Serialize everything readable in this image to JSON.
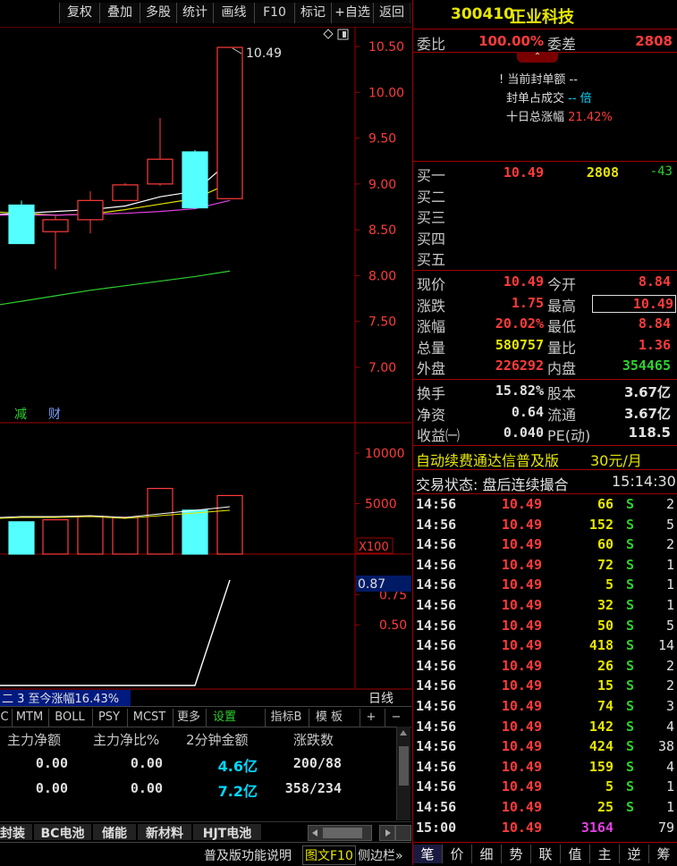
{
  "toolbar": {
    "items": [
      "复权",
      "叠加",
      "多股",
      "统计",
      "画线",
      "F10",
      "标记",
      "+自选",
      "返回"
    ]
  },
  "stock": {
    "code": "300410",
    "name": "正业科技"
  },
  "order_ratio": {
    "wb_label": "委比",
    "wb_value": "100.00%",
    "wc_label": "委差",
    "wc_value": "2808"
  },
  "seal": {
    "l1_label": "当前封单额",
    "l1_value": "--",
    "l2_label": "封单占成交",
    "l2_value": "-- 倍",
    "l3_label": "十日总涨幅",
    "l3_value": "21.42%"
  },
  "bids": [
    {
      "label": "买一",
      "price": "10.49",
      "vol": "2808",
      "chg": "-43"
    },
    {
      "label": "买二",
      "price": "",
      "vol": "",
      "chg": ""
    },
    {
      "label": "买三",
      "price": "",
      "vol": "",
      "chg": ""
    },
    {
      "label": "买四",
      "price": "",
      "vol": "",
      "chg": ""
    },
    {
      "label": "买五",
      "price": "",
      "vol": "",
      "chg": ""
    }
  ],
  "quote": [
    {
      "l1": "现价",
      "v1": "10.49",
      "l2": "今开",
      "v2": "8.84"
    },
    {
      "l1": "涨跌",
      "v1": "1.75",
      "l2": "最高",
      "v2": "10.49"
    },
    {
      "l1": "涨幅",
      "v1": "20.02%",
      "l2": "最低",
      "v2": "8.84"
    },
    {
      "l1": "总量",
      "v1": "580757",
      "l2": "量比",
      "v2": "1.36"
    },
    {
      "l1": "外盘",
      "v1": "226292",
      "l2": "内盘",
      "v2": "354465"
    }
  ],
  "stats": [
    {
      "l1": "换手",
      "v1": "15.82%",
      "l2": "股本",
      "v2": "3.67亿"
    },
    {
      "l1": "净资",
      "v1": "0.64",
      "l2": "流通",
      "v2": "3.67亿"
    },
    {
      "l1": "收益㈠",
      "v1": "0.040",
      "l2": "PE(动)",
      "v2": "118.5"
    }
  ],
  "promo": {
    "text": "自动续费通达信普及版",
    "price": "30元/月"
  },
  "trade_status": {
    "label": "交易状态: 盘后连续撮合",
    "time": "15:14:30"
  },
  "ticks": [
    [
      "14:56",
      "10.49",
      "66",
      "S",
      "2"
    ],
    [
      "14:56",
      "10.49",
      "152",
      "S",
      "5"
    ],
    [
      "14:56",
      "10.49",
      "60",
      "S",
      "2"
    ],
    [
      "14:56",
      "10.49",
      "72",
      "S",
      "1"
    ],
    [
      "14:56",
      "10.49",
      "5",
      "S",
      "1"
    ],
    [
      "14:56",
      "10.49",
      "32",
      "S",
      "1"
    ],
    [
      "14:56",
      "10.49",
      "50",
      "S",
      "5"
    ],
    [
      "14:56",
      "10.49",
      "418",
      "S",
      "14"
    ],
    [
      "14:56",
      "10.49",
      "26",
      "S",
      "2"
    ],
    [
      "14:56",
      "10.49",
      "15",
      "S",
      "2"
    ],
    [
      "14:56",
      "10.49",
      "74",
      "S",
      "3"
    ],
    [
      "14:56",
      "10.49",
      "142",
      "S",
      "4"
    ],
    [
      "14:56",
      "10.49",
      "424",
      "S",
      "38"
    ],
    [
      "14:56",
      "10.49",
      "159",
      "S",
      "4"
    ],
    [
      "14:56",
      "10.49",
      "5",
      "S",
      "1"
    ],
    [
      "14:56",
      "10.49",
      "25",
      "S",
      "1"
    ],
    [
      "15:00",
      "10.49",
      "3164",
      "",
      "79"
    ]
  ],
  "rp_tabs": [
    "笔",
    "价",
    "细",
    "势",
    "联",
    "值",
    "主",
    "逆",
    "筹"
  ],
  "chart_data": [
    {
      "type": "candlestick",
      "yticks": [
        "10.50",
        "10.00",
        "9.50",
        "9.00",
        "8.50",
        "8.00",
        "7.50",
        "7.00"
      ],
      "max_label": "10.49",
      "candles": [
        {
          "open": 8.77,
          "close": 8.35,
          "high": 8.82,
          "low": 8.35
        },
        {
          "open": 8.48,
          "close": 8.61,
          "high": 8.65,
          "low": 8.07
        },
        {
          "open": 8.61,
          "close": 8.82,
          "high": 8.92,
          "low": 8.46
        },
        {
          "open": 8.82,
          "close": 8.99,
          "high": 9.01,
          "low": 8.82
        },
        {
          "open": 9.0,
          "close": 9.27,
          "high": 9.72,
          "low": 8.98
        },
        {
          "open": 9.35,
          "close": 8.74,
          "high": 9.37,
          "low": 8.73
        },
        {
          "open": 8.84,
          "close": 10.49,
          "high": 10.49,
          "low": 8.84
        }
      ],
      "ma": [
        {
          "color": "#ffffff",
          "values": [
            8.68,
            8.7,
            8.72,
            8.76,
            8.86,
            8.92,
            9.25
          ]
        },
        {
          "color": "#e6e600",
          "values": [
            8.68,
            8.66,
            8.67,
            8.72,
            8.78,
            8.84,
            9.01
          ]
        },
        {
          "color": "#e040e0",
          "values": [
            8.66,
            8.66,
            8.67,
            8.68,
            8.7,
            8.73,
            8.82
          ]
        },
        {
          "color": "#2dd12d",
          "values": [
            7.72,
            7.78,
            7.84,
            7.89,
            7.94,
            7.99,
            8.05
          ]
        }
      ],
      "badges": [
        "减",
        "财"
      ]
    },
    {
      "type": "bar",
      "yticks": [
        "10000",
        "5000"
      ],
      "unit_label": "X100",
      "values": [
        3200,
        3400,
        3750,
        3650,
        6500,
        4350,
        5800
      ]
    },
    {
      "type": "line",
      "yticks": [
        "0.75",
        "0.50"
      ],
      "current": "0.87",
      "values": [
        null,
        null,
        null,
        null,
        null,
        0.0,
        0.87
      ],
      "caption": "二 3 至今涨幅16.43%",
      "period": "日线"
    }
  ],
  "indicator_tabs": [
    "C",
    "MTM",
    "BOLL",
    "PSY",
    "MCST",
    "更多",
    "设置",
    "指标B",
    "模 板",
    "+",
    "−"
  ],
  "fund_table": {
    "headers": [
      "主力净额",
      "主力净比%",
      "2分钟金额",
      "涨跌数"
    ],
    "rows": [
      [
        "0.00",
        "0.00",
        "4.6亿",
        "200/88"
      ],
      [
        "0.00",
        "0.00",
        "7.2亿",
        "358/234"
      ]
    ]
  },
  "sector_tabs": [
    "封装",
    "BC电池",
    "储能",
    "新材料",
    "HJT电池"
  ],
  "status_bar": {
    "help": "普及版功能说明",
    "f10": "图文F10",
    "sidebar": "侧边栏»"
  }
}
